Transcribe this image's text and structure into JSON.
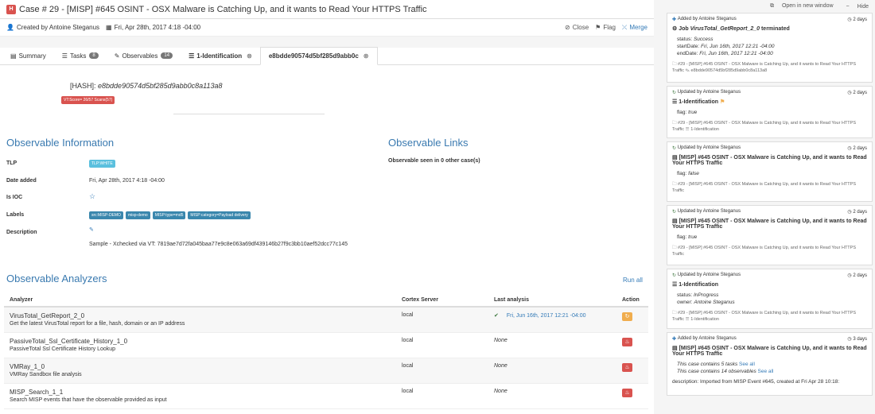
{
  "header": {
    "badge": "H",
    "title": "Case # 29 - [MISP] #645 OSINT - OSX Malware is Catching Up, and it wants to Read Your HTTPS Traffic"
  },
  "subbar": {
    "created_by": "Created by Antoine Steganus",
    "date": "Fri, Apr 28th, 2017 4:18 -04:00",
    "close": "Close",
    "flag": "Flag",
    "merge": "Merge"
  },
  "tabs": [
    {
      "label": "Summary"
    },
    {
      "label": "Tasks",
      "count": "8"
    },
    {
      "label": "Observables",
      "count": "14"
    },
    {
      "label": "1-Identification",
      "close": "⊗"
    },
    {
      "label": "e8bdde90574d5bf285d9abb0c",
      "close": "⊗"
    }
  ],
  "observable": {
    "hash_label": "[HASH]:",
    "hash_value": "e8bdde90574d5bf285d9abb0c8a113a8",
    "vt_badge": "VT:Score= 26/57 Scans(57)",
    "info_title": "Observable Information",
    "links_title": "Observable Links",
    "links_text": "Observable seen in 0 other case(s)",
    "tlp_label": "TLP",
    "tlp_value": "TLP:WHITE",
    "date_label": "Date added",
    "date_value": "Fri, Apr 28th, 2017 4:18 -04:00",
    "ioc_label": "Is IOC",
    "labels_label": "Labels",
    "tags": [
      "src:MISP-DEMO",
      "misp-demo",
      "MISP:type=md5",
      "MISP:category=Payload delivery"
    ],
    "desc_label": "Description",
    "desc_value": "Sample - Xchecked via VT: 7819ae7d72fa045baa77e9c8e063a69df439146b27f9c3bb10aef52dcc77c145"
  },
  "analyzers": {
    "title": "Observable Analyzers",
    "run_all": "Run all",
    "headers": [
      "Analyzer",
      "Cortex Server",
      "Last analysis",
      "Action"
    ],
    "rows": [
      {
        "name": "VirusTotal_GetReport_2_0",
        "desc": "Get the latest VirusTotal report for a file, hash, domain or an IP address",
        "server": "local",
        "last": "Fri, Jun 16th, 2017 12:21 -04:00",
        "ok": "✔"
      },
      {
        "name": "PassiveTotal_Ssl_Certificate_History_1_0",
        "desc": "PassiveTotal Ssl Certificate History Lookup",
        "server": "local",
        "last": "None"
      },
      {
        "name": "VMRay_1_0",
        "desc": "VMRay Sandbox file analysis",
        "server": "local",
        "last": "None"
      },
      {
        "name": "MISP_Search_1_1",
        "desc": "Search MISP events that have the observable provided as input",
        "server": "local",
        "last": "None"
      }
    ]
  },
  "sidebar": {
    "open": "Open in new window",
    "hide": "Hide",
    "cards": [
      {
        "meta": "Added by Antoine Steganus",
        "time": "2 days",
        "title_prefix": "Job ",
        "title_em": "VirusTotal_GetReport_2_0",
        "title_suffix": " terminated",
        "lines": [
          [
            "status: ",
            "Success"
          ],
          [
            "startDate: ",
            "Fri, Jun 16th, 2017 12:21 -04:00"
          ],
          [
            "endDate: ",
            "Fri, Jun 16th, 2017 12:21 -04:00"
          ]
        ],
        "foot": "#29 - [MISP] #645 OSINT - OSX Malware is Catching Up, and it wants to Read Your HTTPS Traffic ✎ e8bdde90574d5bf285d9abb0c8a113a8"
      },
      {
        "meta": "Updated by Antoine Steganus",
        "time": "2 days",
        "title": "1-Identification",
        "lines": [
          [
            "flag: ",
            "true"
          ]
        ],
        "foot": "#29 - [MISP] #645 OSINT - OSX Malware is Catching Up, and it wants to Read Your HTTPS Traffic ☰ 1-Identification"
      },
      {
        "meta": "Updated by Antoine Steganus",
        "time": "2 days",
        "title": "[MISP] #645 OSINT - OSX Malware is Catching Up, and it wants to Read Your HTTPS Traffic",
        "lines": [
          [
            "flag: ",
            "false"
          ]
        ],
        "foot": "#29 - [MISP] #645 OSINT - OSX Malware is Catching Up, and it wants to Read Your HTTPS Traffic"
      },
      {
        "meta": "Updated by Antoine Steganus",
        "time": "2 days",
        "title": "[MISP] #645 OSINT - OSX Malware is Catching Up, and it wants to Read Your HTTPS Traffic",
        "lines": [
          [
            "flag: ",
            "true"
          ]
        ],
        "foot": "#29 - [MISP] #645 OSINT - OSX Malware is Catching Up, and it wants to Read Your HTTPS Traffic"
      },
      {
        "meta": "Updated by Antoine Steganus",
        "time": "2 days",
        "title": "1-Identification",
        "lines": [
          [
            "status: ",
            "InProgress"
          ],
          [
            "owner: ",
            "Antoine Steganus"
          ]
        ],
        "foot": "#29 - [MISP] #645 OSINT - OSX Malware is Catching Up, and it wants to Read Your HTTPS Traffic ☰ 1-Identification"
      },
      {
        "meta": "Added by Antoine Steganus",
        "time": "3 days",
        "title": "[MISP] #645 OSINT - OSX Malware is Catching Up, and it wants to Read Your HTTPS Traffic",
        "lines": [
          [
            "",
            "This case contains 5 tasks"
          ],
          [
            "",
            "This case contains 14 observables"
          ]
        ],
        "see_all": "See all",
        "foot": "description: Imported from MISP Event #645, created at Fri Apr 28 10:18:"
      }
    ]
  }
}
